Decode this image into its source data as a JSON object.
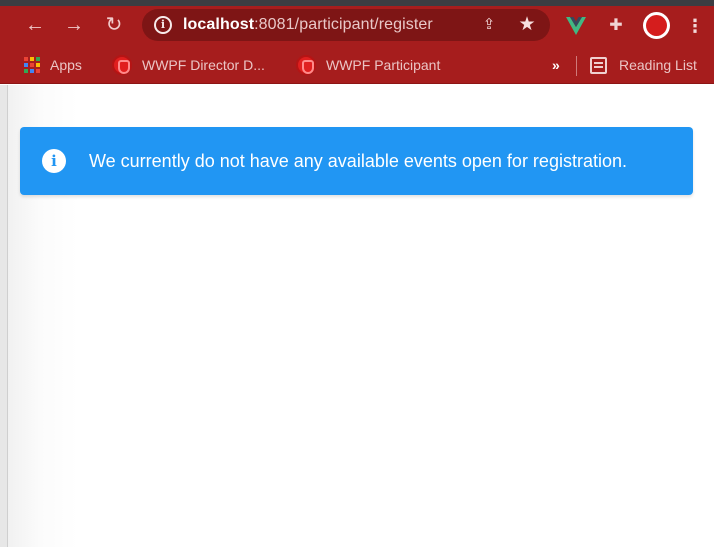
{
  "browser": {
    "url_host": "localhost",
    "url_path": ":8081/participant/register",
    "colors": {
      "frame": "#a61d1d",
      "omnibox": "#7e1515"
    },
    "icons": {
      "back": "arrow-left-icon",
      "forward": "arrow-right-icon",
      "reload": "reload-icon",
      "info": "info-icon",
      "share": "share-icon",
      "bookmark": "star-icon",
      "vue_extension": "vue-devtools-icon",
      "extensions": "puzzle-icon",
      "profile": "profile-avatar",
      "menu": "kebab-menu-icon"
    }
  },
  "bookmarks_bar": {
    "items": [
      {
        "label": "Apps",
        "icon": "apps-grid-icon"
      },
      {
        "label": "WWPF Director D...",
        "icon": "shield-favicon"
      },
      {
        "label": "WWPF Participant",
        "icon": "shield-favicon"
      }
    ],
    "overflow_glyph": "»",
    "reading_list_label": "Reading List"
  },
  "page": {
    "alert": {
      "type": "info",
      "color": "#2196f3",
      "icon": "info-circle-icon",
      "message": "We currently do not have any available events open for registration."
    }
  }
}
